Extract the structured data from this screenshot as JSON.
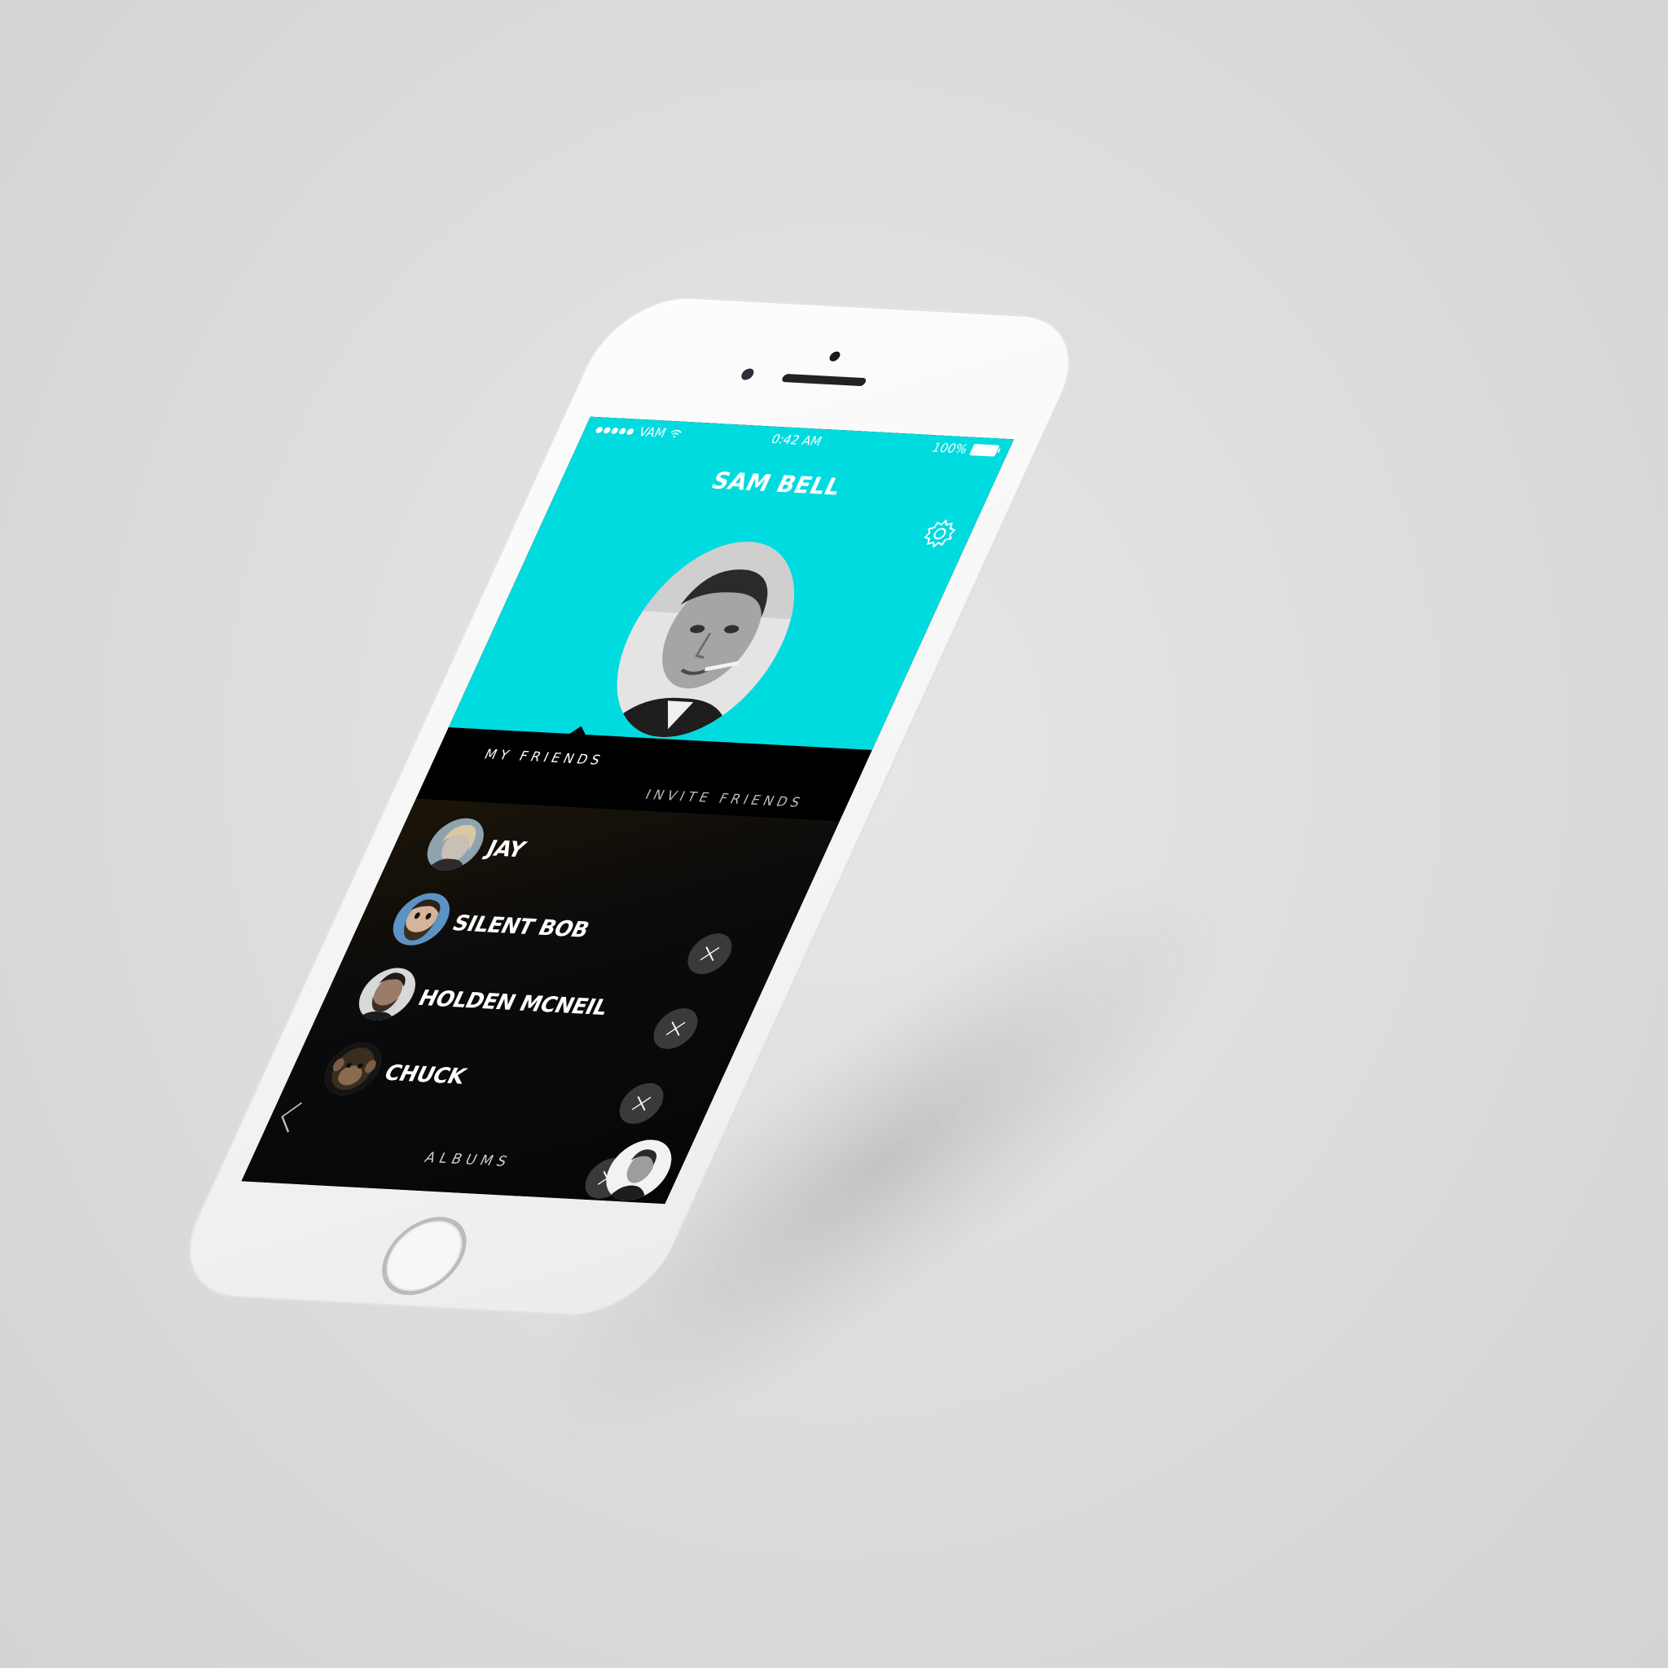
{
  "status_bar": {
    "signal": "●●●●●",
    "carrier": "VAM",
    "time": "0:42 AM",
    "battery": "100%"
  },
  "profile": {
    "name": "SAM BELL"
  },
  "tabs": {
    "my_friends": "MY FRIENDS",
    "invite_friends": "INVITE FRIENDS",
    "active": "MY FRIENDS"
  },
  "friends": [
    {
      "name": "JAY",
      "removable": false
    },
    {
      "name": "SILENT BOB",
      "removable": true
    },
    {
      "name": "HOLDEN MCNEIL",
      "removable": true
    },
    {
      "name": "CHUCK",
      "removable": true
    }
  ],
  "footer": {
    "albums_label": "ALBUMS"
  },
  "icons": {
    "settings": "gear-icon",
    "back": "chevron-left-icon",
    "remove": "close-icon",
    "wifi": "wifi-icon",
    "battery": "battery-icon"
  },
  "colors": {
    "header": "#00dbe0",
    "background": "#000000",
    "text": "#ffffff",
    "remove_button": "#3a3a3c"
  }
}
